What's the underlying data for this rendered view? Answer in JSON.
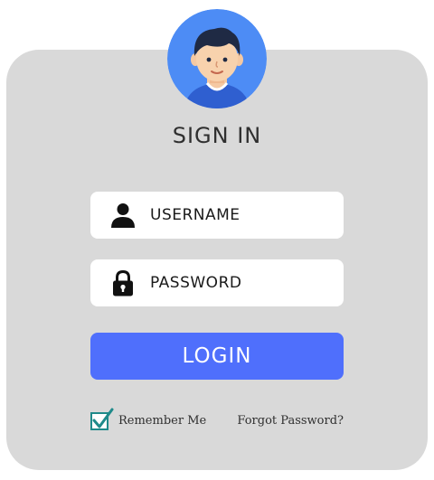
{
  "form": {
    "title": "SIGN IN",
    "username": {
      "placeholder": "USERNAME",
      "value": "",
      "icon": "user-icon"
    },
    "password": {
      "placeholder": "PASSWORD",
      "value": "",
      "icon": "lock-icon"
    },
    "login_label": "LOGIN",
    "remember_label": "Remember Me",
    "remember_checked": true,
    "forgot_label": "Forgot Password?"
  },
  "colors": {
    "card": "#d9d9d9",
    "accent": "#4f6ffc",
    "avatar_bg": "#4d8cf5",
    "check": "#1f8a8a"
  }
}
